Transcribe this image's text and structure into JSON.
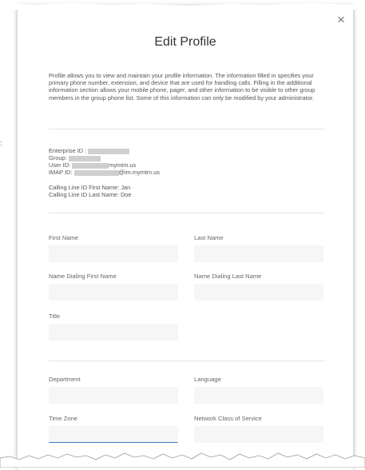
{
  "modal": {
    "title": "Edit Profile",
    "close_label": "×",
    "intro": "Profile allows you to view and maintain your profile information. The information filled in specifies your primary phone number, extension, and device that are used for handling calls. Filling in the additional information section allows your mobile phone, pager, and other information to be visible to other group members in the group phone list. Some of this information can only be modified by your administrator."
  },
  "account": {
    "enterprise_label": "Enterprise ID :",
    "group_label": "Group:",
    "user_label": "User ID: ",
    "user_suffix": "mymtm.us",
    "imap_label": "IMAP ID:",
    "imap_suffix": "@im.mymtm.us",
    "calling_first": "Calling Line ID First Name: Jan",
    "calling_last": "Calling Line ID Last Name: Doe"
  },
  "form": {
    "first_name": "First Name",
    "last_name": "Last Name",
    "name_dialing_first": "Name Dialing First Name",
    "name_dialing_last": "Name Dialing Last Name",
    "title": "Title",
    "department": "Department",
    "language": "Language",
    "time_zone": "Time Zone",
    "network_class": "Network Class of Service"
  },
  "background": {
    "edge_glyph": ":"
  }
}
